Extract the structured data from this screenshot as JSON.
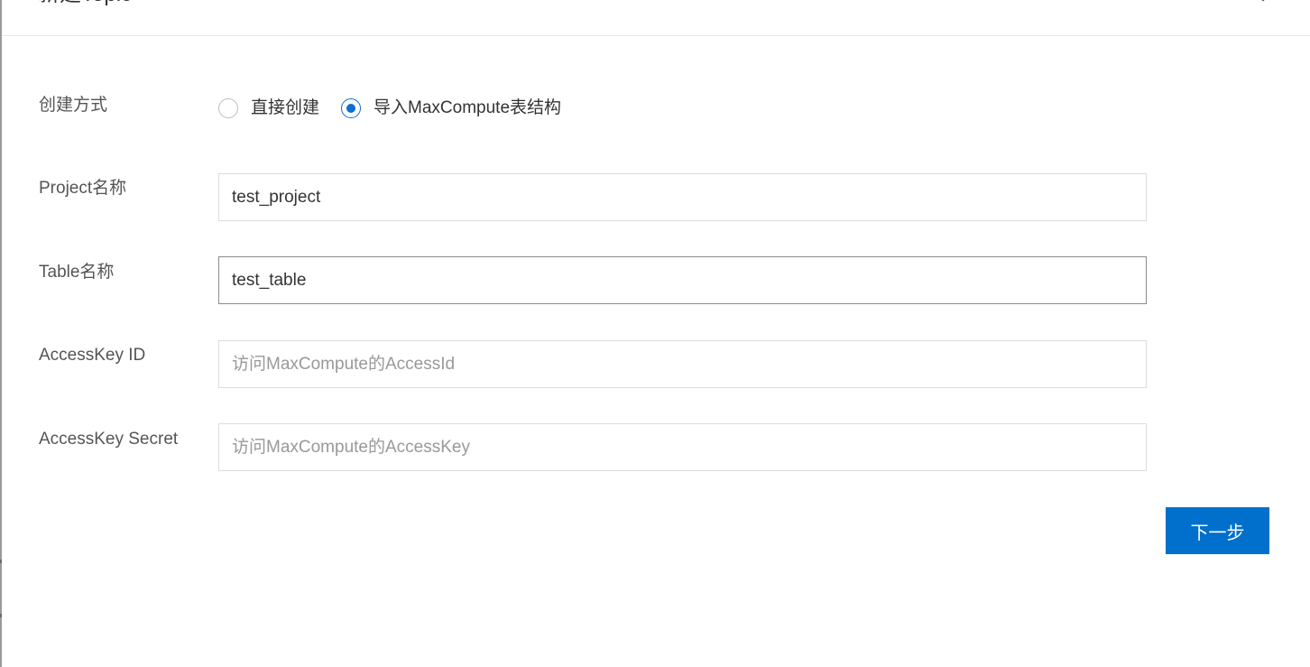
{
  "dialog": {
    "title": "新建Topic"
  },
  "form": {
    "creation_method_label": "创建方式",
    "creation_options": [
      {
        "label": "直接创建",
        "selected": false
      },
      {
        "label": "导入MaxCompute表结构",
        "selected": true
      }
    ],
    "project_label": "Project名称",
    "project_value": "test_project",
    "table_label": "Table名称",
    "table_value": "test_table",
    "access_key_id_label": "AccessKey ID",
    "access_key_id_placeholder": "访问MaxCompute的AccessId",
    "access_key_secret_label": "AccessKey Secret",
    "access_key_secret_placeholder": "访问MaxCompute的AccessKey"
  },
  "actions": {
    "next_label": "下一步"
  },
  "colors": {
    "accent": "#0070cc",
    "radio_selected": "#0b6fcf",
    "label_text": "#555555",
    "input_border": "#dcdcdc"
  },
  "icons": {
    "close": "close-icon"
  }
}
